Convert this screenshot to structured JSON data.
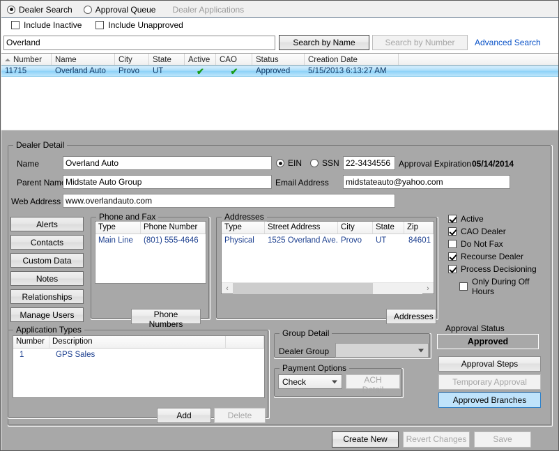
{
  "topbar": {
    "mode_options": [
      {
        "label": "Dealer Search",
        "selected": true
      },
      {
        "label": "Approval Queue",
        "selected": false
      }
    ],
    "section_title": "Dealer Applications"
  },
  "filters": [
    {
      "label": "Include Inactive",
      "checked": false
    },
    {
      "label": "Include Unapproved",
      "checked": false
    }
  ],
  "search": {
    "value": "Overland",
    "placeholder": "",
    "search_by_name": "Search by Name",
    "search_by_number": "Search by Number",
    "advanced_search": "Advanced Search"
  },
  "results_grid": {
    "columns": [
      "Number",
      "Name",
      "City",
      "State",
      "Active",
      "CAO",
      "Status",
      "Creation Date",
      ""
    ],
    "sort_column": "Number",
    "rows": [
      {
        "number": "11715",
        "name": "Overland Auto",
        "city": "Provo",
        "state": "UT",
        "active": "✔",
        "cao": "✔",
        "status": "Approved",
        "creation_date": "5/15/2013 6:13:27 AM",
        "selected": true
      }
    ]
  },
  "dealer_detail": {
    "title": "Dealer Detail",
    "name_label": "Name",
    "name_value": "Overland Auto",
    "parent_name_label": "Parent Name",
    "parent_name_value": "Midstate Auto Group",
    "web_address_label": "Web Address",
    "web_address_value": "www.overlandauto.com",
    "ein_label": "EIN",
    "ssn_label": "SSN",
    "tax_id_value": "22-3434556",
    "approval_expiration_label": "Approval Expiration",
    "approval_expiration_value": "05/14/2014",
    "email_label": "Email Address",
    "email_value": "midstateauto@yahoo.com"
  },
  "side_buttons": [
    "Alerts",
    "Contacts",
    "Custom Data",
    "Notes",
    "Relationships",
    "Manage Users"
  ],
  "phone_and_fax": {
    "title": "Phone and Fax",
    "columns": [
      "Type",
      "Phone Number"
    ],
    "rows": [
      {
        "type": "Main Line",
        "number": "(801) 555-4646"
      }
    ],
    "button": "Phone Numbers"
  },
  "addresses": {
    "title": "Addresses",
    "columns": [
      "Type",
      "Street Address",
      "City",
      "State",
      "Zip"
    ],
    "rows": [
      {
        "type": "Physical",
        "street": "1525 Overland Ave.",
        "city": "Provo",
        "state": "UT",
        "zip": "84601"
      }
    ],
    "button": "Addresses"
  },
  "flags": [
    {
      "label": "Active",
      "checked": true,
      "indent": false
    },
    {
      "label": "CAO Dealer",
      "checked": true,
      "indent": false
    },
    {
      "label": "Do Not Fax",
      "checked": false,
      "indent": false
    },
    {
      "label": "Recourse Dealer",
      "checked": true,
      "indent": false
    },
    {
      "label": "Process Decisioning",
      "checked": true,
      "indent": false
    },
    {
      "label": "Only During Off Hours",
      "checked": false,
      "indent": true
    }
  ],
  "application_types": {
    "title": "Application Types",
    "columns": [
      "Number",
      "Description",
      ""
    ],
    "rows": [
      {
        "number": "1",
        "description": "GPS Sales"
      }
    ],
    "add_button": "Add",
    "delete_button": "Delete"
  },
  "group_detail": {
    "title": "Group Detail",
    "dealer_group_label": "Dealer Group",
    "dealer_group_value": ""
  },
  "payment_options": {
    "title": "Payment Options",
    "method_value": "Check",
    "ach_detail_button": "ACH Detail"
  },
  "approval": {
    "title": "Approval Status",
    "status_value": "Approved",
    "approval_steps_button": "Approval Steps",
    "temporary_approval_button": "Temporary Approval",
    "approved_branches_button": "Approved Branches"
  },
  "footer": {
    "create_new": "Create New",
    "revert_changes": "Revert Changes",
    "save": "Save"
  },
  "colors": {
    "accent_blue": "#0a53c8",
    "selection_blue": "#a8ddfa",
    "check_green": "#179b17",
    "panel_gray": "#a8a8a8",
    "highlight_button": "#bfe3fb"
  }
}
